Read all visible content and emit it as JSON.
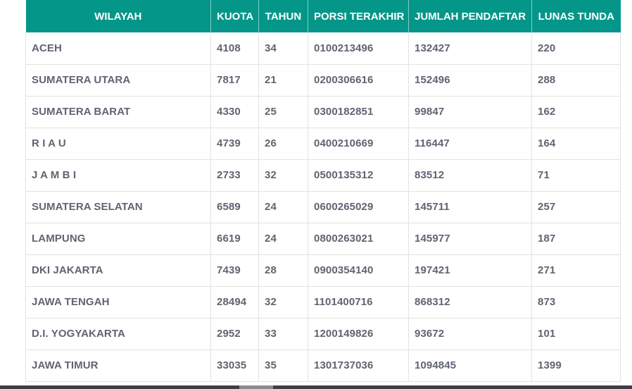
{
  "table": {
    "headers": [
      "WILAYAH",
      "KUOTA",
      "TAHUN",
      "PORSI TERAKHIR",
      "JUMLAH PENDAFTAR",
      "LUNAS TUNDA"
    ],
    "rows": [
      [
        "ACEH",
        "4108",
        "34",
        "0100213496",
        "132427",
        "220"
      ],
      [
        "SUMATERA UTARA",
        "7817",
        "21",
        "0200306616",
        "152496",
        "288"
      ],
      [
        "SUMATERA BARAT",
        "4330",
        "25",
        "0300182851",
        "99847",
        "162"
      ],
      [
        "R I A U",
        "4739",
        "26",
        "0400210669",
        "116447",
        "164"
      ],
      [
        "J A M B I",
        "2733",
        "32",
        "0500135312",
        "83512",
        "71"
      ],
      [
        "SUMATERA SELATAN",
        "6589",
        "24",
        "0600265029",
        "145711",
        "257"
      ],
      [
        "LAMPUNG",
        "6619",
        "24",
        "0800263021",
        "145977",
        "187"
      ],
      [
        "DKI JAKARTA",
        "7439",
        "28",
        "0900354140",
        "197421",
        "271"
      ],
      [
        "JAWA TENGAH",
        "28494",
        "32",
        "1101400716",
        "868312",
        "873"
      ],
      [
        "D.I. YOGYAKARTA",
        "2952",
        "33",
        "1200149826",
        "93672",
        "101"
      ],
      [
        "JAWA TIMUR",
        "33035",
        "35",
        "1301737036",
        "1094845",
        "1399"
      ]
    ]
  },
  "colors": {
    "header_bg": "#05968a",
    "header_text": "#ffffff",
    "cell_text": "#5f6472",
    "border": "#e2e2e2"
  }
}
